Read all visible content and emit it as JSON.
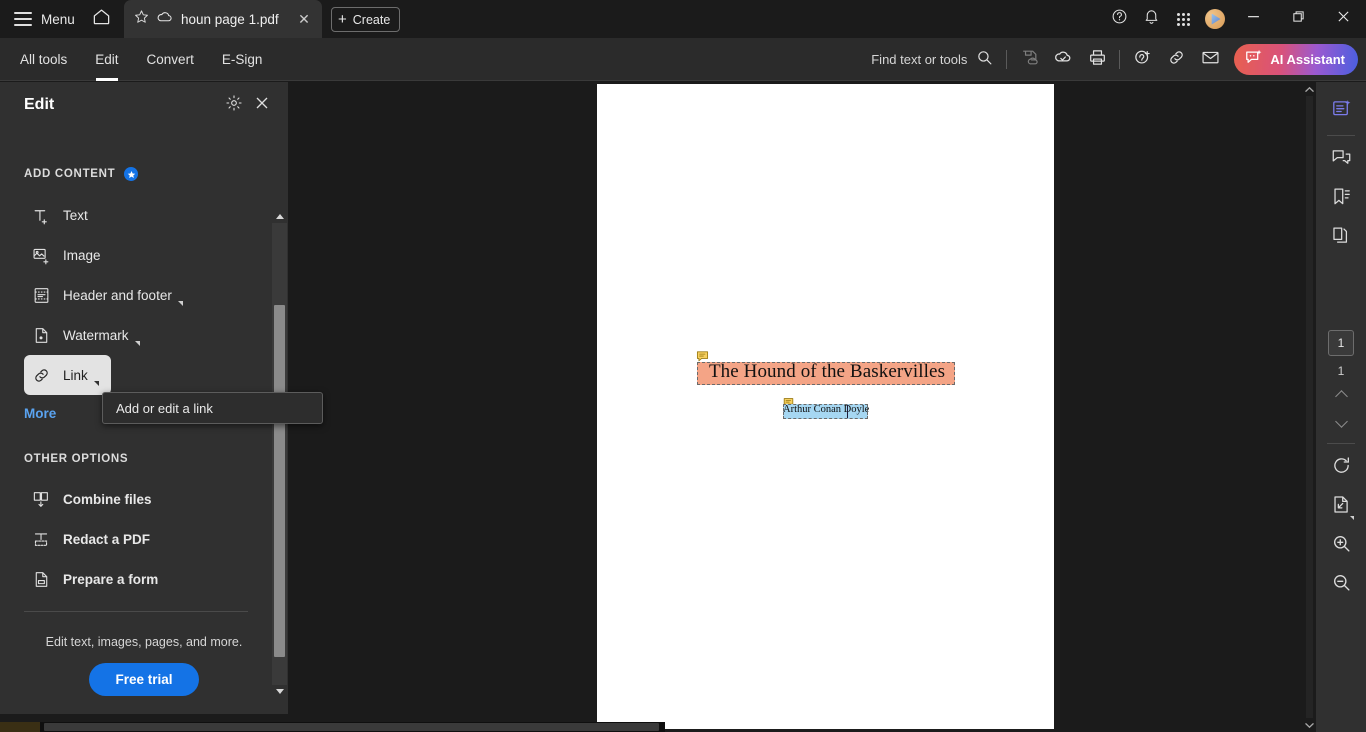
{
  "titlebar": {
    "menu_label": "Menu",
    "home_icon": "home-icon",
    "tab": {
      "star_icon": "star-icon",
      "cloud_icon": "cloud-icon",
      "name": "houn page 1.pdf",
      "close_icon": "close-icon"
    },
    "create_label": "Create",
    "create_plus": "+",
    "icons": [
      "help-icon",
      "bell-icon",
      "apps-grid-icon",
      "avatar"
    ],
    "window_controls": {
      "minimize": "—",
      "restore": "restore-icon",
      "close": "✕"
    }
  },
  "menubar": {
    "items": [
      {
        "label": "All tools",
        "active": false
      },
      {
        "label": "Edit",
        "active": true
      },
      {
        "label": "Convert",
        "active": false
      },
      {
        "label": "E-Sign",
        "active": false
      }
    ],
    "find_label": "Find text or tools",
    "tools": [
      "save-icon",
      "cloud-sync-icon",
      "print-icon",
      "add-stamp-icon",
      "link-icon",
      "mail-icon"
    ],
    "ai_button_label": "AI Assistant",
    "ai_gradient_start": "#e8604f",
    "ai_gradient_end": "#4a5fe0"
  },
  "left_panel": {
    "title": "Edit",
    "gear_icon": "gear-icon",
    "close_icon": "close-icon",
    "add_content_header": "ADD CONTENT",
    "premium_badge": "star-badge-icon",
    "add_content_items": [
      {
        "label": "Text",
        "icon": "add-text-icon",
        "caret": false,
        "highlighted": false
      },
      {
        "label": "Image",
        "icon": "add-image-icon",
        "caret": false,
        "highlighted": false
      },
      {
        "label": "Header and footer",
        "icon": "header-footer-icon",
        "caret": true,
        "highlighted": false
      },
      {
        "label": "Watermark",
        "icon": "watermark-icon",
        "caret": true,
        "highlighted": false
      },
      {
        "label": "Link",
        "icon": "link-icon",
        "caret": true,
        "highlighted": true
      }
    ],
    "more_label": "More",
    "other_options_header": "OTHER OPTIONS",
    "other_options_items": [
      {
        "label": "Combine files",
        "icon": "combine-files-icon"
      },
      {
        "label": "Redact a PDF",
        "icon": "redact-icon"
      },
      {
        "label": "Prepare a form",
        "icon": "prepare-form-icon"
      }
    ],
    "footer_text": "Edit text, images, pages, and more.",
    "free_trial_label": "Free trial",
    "accent_color": "#1473e6"
  },
  "tooltip": {
    "text": "Add or edit a link"
  },
  "vertical_toolbar": {
    "tools": [
      {
        "icon": "select-cursor-icon",
        "active": true,
        "caret": true
      },
      {
        "icon": "add-comment-icon",
        "active": false,
        "caret": true
      },
      {
        "icon": "highlighter-icon",
        "active": false,
        "caret": true
      },
      {
        "icon": "lasso-draw-icon",
        "active": false,
        "caret": true
      },
      {
        "icon": "text-select-icon",
        "active": false,
        "caret": true
      },
      {
        "icon": "signature-icon",
        "active": false,
        "caret": true
      }
    ]
  },
  "document": {
    "title_text": "The Hound of the Baskervilles",
    "title_highlight_color": "#f4a486",
    "author_text": "Arthur Conan Doyle",
    "author_highlight_color": "#a6d7f2",
    "comment_icon": "comment-bubble-icon",
    "page_background": "#ffffff"
  },
  "right_rail": {
    "icons": [
      {
        "name": "ai-summary-icon",
        "accent": "#6c6ce0"
      },
      {
        "name": "comments-icon"
      },
      {
        "name": "bookmarks-icon"
      },
      {
        "name": "page-thumbnails-icon"
      }
    ],
    "current_page": "1",
    "total_pages": "1",
    "prev_page_icon": "chevron-up-icon",
    "next_page_icon": "chevron-down-icon",
    "bottom_icons": [
      "rotate-icon",
      "fit-page-icon",
      "zoom-in-icon",
      "zoom-out-icon"
    ]
  }
}
